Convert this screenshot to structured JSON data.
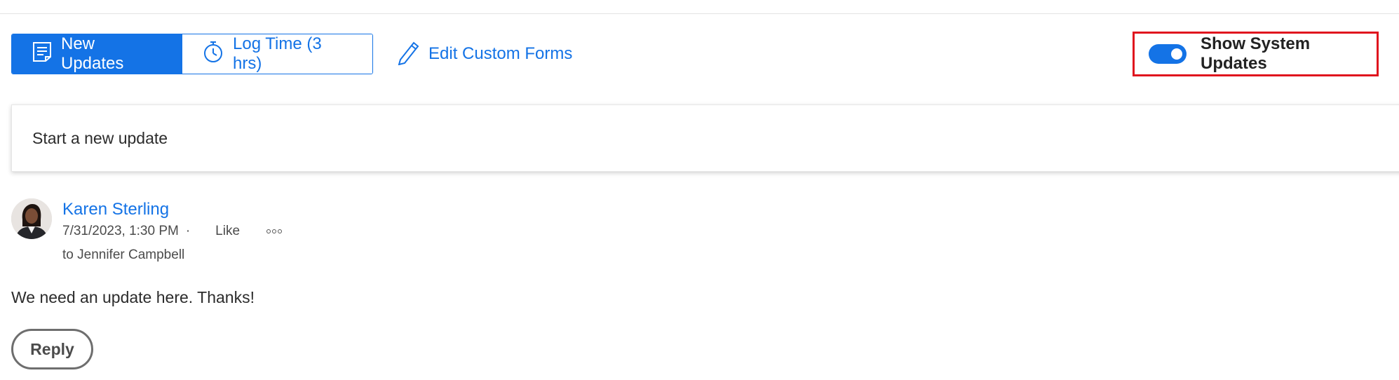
{
  "toolbar": {
    "new_updates_label": "New Updates",
    "log_time_label": "Log Time (3 hrs)",
    "edit_forms_label": "Edit Custom Forms",
    "show_system_updates_label": "Show System Updates",
    "show_system_updates_on": true
  },
  "composer": {
    "placeholder": "Start a new update"
  },
  "post": {
    "author": "Karen Sterling",
    "timestamp": "7/31/2023, 1:30 PM",
    "separator": "·",
    "like_label": "Like",
    "recipient": "to Jennifer Campbell",
    "body": "We need an update here. Thanks!",
    "reply_label": "Reply"
  },
  "colors": {
    "accent": "#1473e6",
    "highlight_border": "#e0141e"
  },
  "icons": {
    "new_updates": "note-icon",
    "log_time": "stopwatch-icon",
    "edit_forms": "pencil-icon",
    "more": "more-options-icon"
  }
}
